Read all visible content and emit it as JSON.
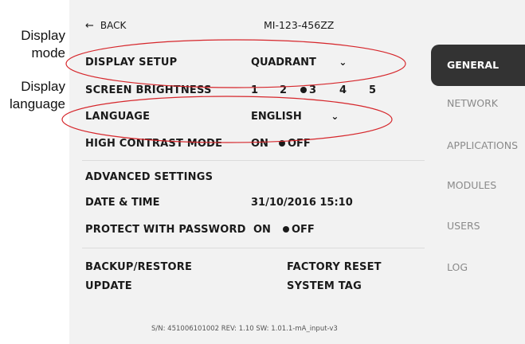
{
  "callouts": {
    "display_mode": [
      "Display",
      "mode"
    ],
    "display_language": [
      "Display",
      "language"
    ]
  },
  "header": {
    "back_label": "BACK",
    "device_id": "MI-123-456ZZ"
  },
  "settings": {
    "display_setup": {
      "label": "DISPLAY SETUP",
      "value": "QUADRANT"
    },
    "screen_brightness": {
      "label": "SCREEN BRIGHTNESS",
      "options": [
        "1",
        "2",
        "3",
        "4",
        "5"
      ],
      "selected": "3"
    },
    "language": {
      "label": "LANGUAGE",
      "value": "ENGLISH"
    },
    "high_contrast": {
      "label": "HIGH CONTRAST MODE",
      "on": "ON",
      "off": "OFF",
      "selected": "OFF"
    }
  },
  "advanced": {
    "title": "ADVANCED SETTINGS",
    "date_time": {
      "label": "DATE & TIME",
      "value": "31/10/2016 15:10"
    },
    "protect_password": {
      "label": "PROTECT WITH PASSWORD",
      "on": "ON",
      "off": "OFF",
      "selected": "OFF"
    }
  },
  "actions": {
    "backup": "BACKUP/RESTORE",
    "update": "UPDATE",
    "factory_reset": "FACTORY RESET",
    "system_tag": "SYSTEM TAG"
  },
  "footer": "S/N: 451006101002  REV: 1.10  SW: 1.01.1-mA_input-v3",
  "sidebar": {
    "items": [
      {
        "label": "GENERAL",
        "active": true
      },
      {
        "label": "NETWORK",
        "active": false
      },
      {
        "label": "APPLICATIONS",
        "active": false
      },
      {
        "label": "MODULES",
        "active": false
      },
      {
        "label": "USERS",
        "active": false
      },
      {
        "label": "LOG",
        "active": false
      }
    ]
  },
  "colors": {
    "sidebar_active_bg": "#333333",
    "annotation_red": "#d6262b",
    "panel_bg": "#f2f2f2"
  },
  "icons": {
    "back": "left-arrow-icon",
    "dropdown": "chevron-down-icon",
    "selected": "filled-dot-icon"
  }
}
